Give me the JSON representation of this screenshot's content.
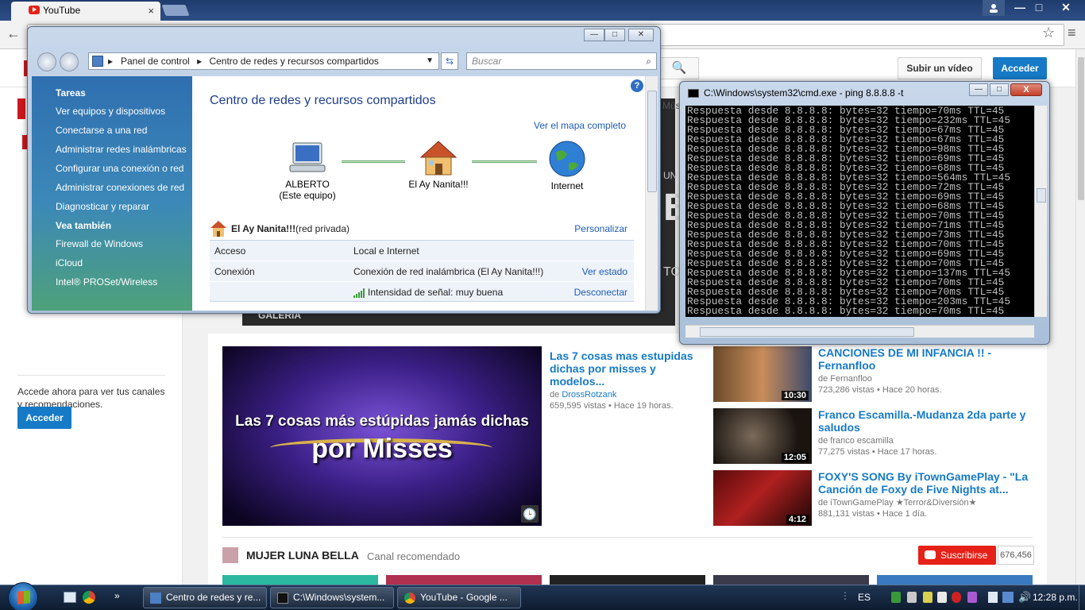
{
  "browser": {
    "tab_title": "YouTube",
    "tab_close": "×",
    "win_min": "—",
    "win_max": "□",
    "win_close": "✕",
    "back": "←",
    "star": "☆",
    "menu": "≡"
  },
  "youtube": {
    "search_icon": "🔍",
    "upload_label": "Subir un vídeo",
    "signin_label": "Acceder",
    "sidebar_promo": "Accede ahora para ver tus canales y recomendaciones.",
    "sidebar_signin": "Acceder",
    "nav_more": "Mús",
    "banner_label": "GALERÍA",
    "banner_letter": "B",
    "banner_un": "UN",
    "banner_to": "TO",
    "featured": {
      "title": "Las 7 cosas mas estupidas dichas por misses y modelos...",
      "by": "de",
      "channel": "DrossRotzank",
      "views": "659,595 vistas",
      "dot": "•",
      "age": "Hace 19 horas.",
      "thumb_line1": "Las 7 cosas más estúpidas jamás dichas",
      "thumb_line2": "por Misses",
      "clock_icon": "🕒"
    },
    "side_videos": [
      {
        "title": "CANCIONES DE MI INFANCIA !! - Fernanfloo",
        "channel": "de Fernanfloo",
        "meta": "723,286 vistas • Hace 20 horas.",
        "duration": "10:30"
      },
      {
        "title": "Franco Escamilla.-Mudanza 2da parte y saludos",
        "channel": "de franco escamilla",
        "meta": "77,275 vistas • Hace 17 horas.",
        "duration": "12:05"
      },
      {
        "title": "FOXY'S SONG By iTownGamePlay - \"La Canción de Foxy de Five Nights at...",
        "channel": "de iTownGamePlay ★Terror&Diversión★",
        "meta": "881,131 vistas • Hace 1 día.",
        "duration": "4:12"
      }
    ],
    "channel": {
      "name": "MUJER LUNA BELLA",
      "tag": "Canal recomendado",
      "subscribe": "Suscribirse",
      "subscribers": "676,456"
    }
  },
  "explorer": {
    "breadcrumb_1": "Panel de control",
    "breadcrumb_sep": "▸",
    "breadcrumb_2": "Centro de redes y recursos compartidos",
    "search_placeholder": "Buscar",
    "search_icon": "⌕",
    "refresh_icon": "⇆",
    "help": "?",
    "left_heading_1": "Tareas",
    "left_links": [
      "Ver equipos y dispositivos",
      "Conectarse a una red",
      "Administrar redes inalámbricas",
      "Configurar una conexión o red",
      "Administrar conexiones de red",
      "Diagnosticar y reparar"
    ],
    "left_heading_2": "Vea también",
    "left_links_2": [
      "Firewall de Windows",
      "iCloud",
      "Intel® PROSet/Wireless"
    ],
    "title": "Centro de redes y recursos compartidos",
    "map_link": "Ver el mapa completo",
    "node_pc": "ALBERTO",
    "node_pc_sub": "(Este equipo)",
    "node_home": "El Ay Nanita!!!",
    "node_internet": "Internet",
    "network_name": "El Ay Nanita!!!",
    "network_type": "(red privada)",
    "customize": "Personalizar",
    "rows": [
      {
        "key": "Acceso",
        "value": "Local e Internet",
        "action": ""
      },
      {
        "key": "Conexión",
        "value": "Conexión de red inalámbrica (El Ay Nanita!!!)",
        "action": "Ver estado"
      },
      {
        "key": "",
        "value": "Intensidad de señal: muy buena",
        "action": "Desconectar"
      }
    ]
  },
  "cmd": {
    "title": "C:\\Windows\\system32\\cmd.exe - ping  8.8.8.8 -t",
    "close": "X",
    "lines": [
      "Respuesta desde 8.8.8.8: bytes=32 tiempo=70ms TTL=45",
      "Respuesta desde 8.8.8.8: bytes=32 tiempo=232ms TTL=45",
      "Respuesta desde 8.8.8.8: bytes=32 tiempo=67ms TTL=45",
      "Respuesta desde 8.8.8.8: bytes=32 tiempo=67ms TTL=45",
      "Respuesta desde 8.8.8.8: bytes=32 tiempo=98ms TTL=45",
      "Respuesta desde 8.8.8.8: bytes=32 tiempo=69ms TTL=45",
      "Respuesta desde 8.8.8.8: bytes=32 tiempo=68ms TTL=45",
      "Respuesta desde 8.8.8.8: bytes=32 tiempo=564ms TTL=45",
      "Respuesta desde 8.8.8.8: bytes=32 tiempo=72ms TTL=45",
      "Respuesta desde 8.8.8.8: bytes=32 tiempo=69ms TTL=45",
      "Respuesta desde 8.8.8.8: bytes=32 tiempo=68ms TTL=45",
      "Respuesta desde 8.8.8.8: bytes=32 tiempo=70ms TTL=45",
      "Respuesta desde 8.8.8.8: bytes=32 tiempo=71ms TTL=45",
      "Respuesta desde 8.8.8.8: bytes=32 tiempo=73ms TTL=45",
      "Respuesta desde 8.8.8.8: bytes=32 tiempo=70ms TTL=45",
      "Respuesta desde 8.8.8.8: bytes=32 tiempo=69ms TTL=45",
      "Respuesta desde 8.8.8.8: bytes=32 tiempo=70ms TTL=45",
      "Respuesta desde 8.8.8.8: bytes=32 tiempo=137ms TTL=45",
      "Respuesta desde 8.8.8.8: bytes=32 tiempo=70ms TTL=45",
      "Respuesta desde 8.8.8.8: bytes=32 tiempo=70ms TTL=45",
      "Respuesta desde 8.8.8.8: bytes=32 tiempo=203ms TTL=45",
      "Respuesta desde 8.8.8.8: bytes=32 tiempo=70ms TTL=45"
    ]
  },
  "taskbar": {
    "more": "»",
    "tasks": [
      "Centro de redes y re...",
      "C:\\Windows\\system...",
      "YouTube - Google ..."
    ],
    "lang": "ES",
    "clock": "12:28 p.m."
  },
  "colors": {
    "youtube_red": "#e62117",
    "youtube_blue": "#167ac6",
    "cmd_text": "#c0c0c0"
  }
}
